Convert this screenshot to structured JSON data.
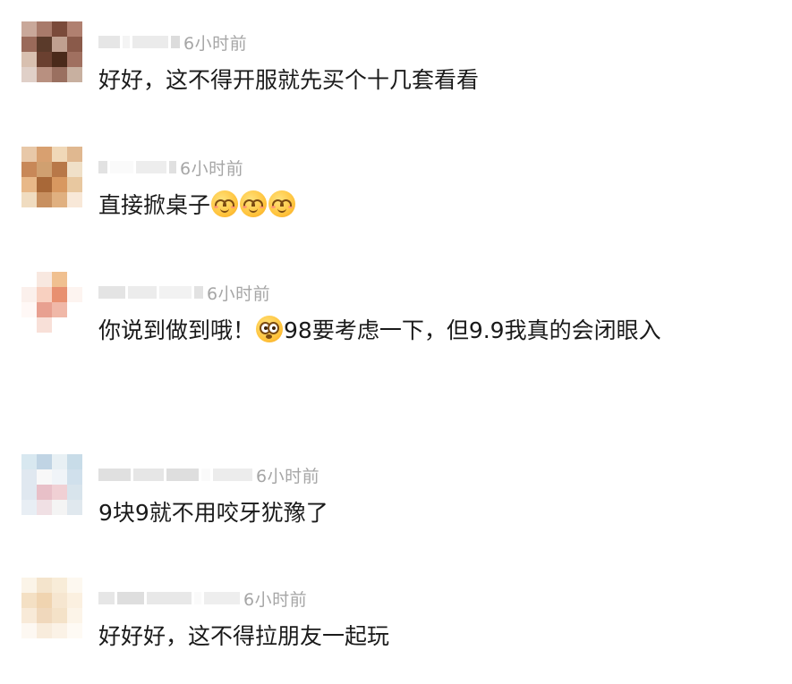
{
  "comments": [
    {
      "time": "6小时前",
      "text": "好好，这不得开服就先买个十几套看看",
      "avatar_colors": [
        "#c9a89a",
        "#a87a6a",
        "#7a4a3a",
        "#b08070",
        "#9a6a5a",
        "#5a3a2a",
        "#c0a090",
        "#8a5a4a",
        "#d8c0b0",
        "#6a4030",
        "#4a2a1a",
        "#a07060",
        "#e0d0c8",
        "#b89080",
        "#9a7060",
        "#c8b0a0"
      ]
    },
    {
      "time": "6小时前",
      "text": "直接掀桌子",
      "emojis": [
        "smirk-emoji",
        "smirk-emoji",
        "smirk-emoji"
      ],
      "avatar_colors": [
        "#e8c8a8",
        "#d8a070",
        "#f0d8b8",
        "#e0b890",
        "#c88858",
        "#d0a070",
        "#b87848",
        "#f0e0c8",
        "#e8b888",
        "#a86838",
        "#d89860",
        "#e8c8a0",
        "#f0dcc0",
        "#c89060",
        "#e0b080",
        "#f8e8d8"
      ]
    },
    {
      "time": "6小时前",
      "text_before": "你说到做到哦！",
      "emoji": "shocked-emoji",
      "text_after": "98要考虑一下，但9.9我真的会闭眼入",
      "avatar_colors": [
        "#ffffff",
        "#f8e8e0",
        "#f0c090",
        "#ffffff",
        "#fbf0ec",
        "#f8d0c0",
        "#e89070",
        "#fdf4f0",
        "#fff8f6",
        "#e8a090",
        "#f0b8a8",
        "#ffffff",
        "#ffffff",
        "#f8e0d8",
        "#ffffff",
        "#ffffff"
      ]
    },
    {
      "time": "6小时前",
      "text": "9块9就不用咬牙犹豫了",
      "avatar_colors": [
        "#d8e8f0",
        "#c0d4e4",
        "#e8f0f4",
        "#c8dce8",
        "#e0e8f0",
        "#f8f8f8",
        "#f0f4f8",
        "#d0e0ec",
        "#e0e8f0",
        "#e8c0c8",
        "#f0d0d4",
        "#d8e4ec",
        "#e8eef4",
        "#f0e0e4",
        "#f4f4f4",
        "#e0e8ee"
      ]
    },
    {
      "time": "6小时前",
      "text": "好好好，这不得拉朋友一起玩",
      "avatar_colors": [
        "#fbf4e8",
        "#f4e4cc",
        "#f8ecd8",
        "#fdf8f0",
        "#f4e0c4",
        "#f0d4b0",
        "#f6e6d0",
        "#fbf0e0",
        "#f8ead8",
        "#f0d8bc",
        "#f4e2c8",
        "#fcf4e8",
        "#fdf8f2",
        "#f8ecdc",
        "#fbf2e6",
        "#fefaf4"
      ]
    }
  ]
}
